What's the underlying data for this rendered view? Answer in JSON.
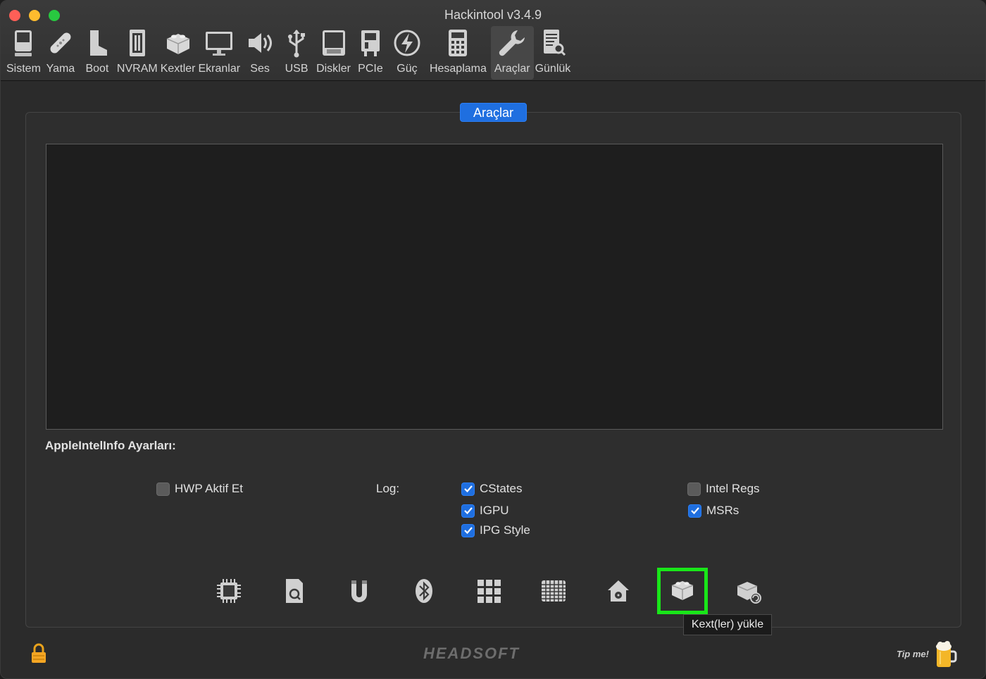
{
  "window": {
    "title": "Hackintool v3.4.9"
  },
  "toolbar": {
    "items": [
      {
        "label": "Sistem",
        "icon": "computer-icon"
      },
      {
        "label": "Yama",
        "icon": "bandage-icon"
      },
      {
        "label": "Boot",
        "icon": "boot-icon"
      },
      {
        "label": "NVRAM",
        "icon": "memory-icon"
      },
      {
        "label": "Kextler",
        "icon": "lego-brick-icon"
      },
      {
        "label": "Ekranlar",
        "icon": "display-icon"
      },
      {
        "label": "Ses",
        "icon": "speaker-icon"
      },
      {
        "label": "USB",
        "icon": "usb-icon"
      },
      {
        "label": "Diskler",
        "icon": "disk-icon"
      },
      {
        "label": "PCIe",
        "icon": "pcie-card-icon"
      },
      {
        "label": "Güç",
        "icon": "power-bolt-icon"
      },
      {
        "label": "Hesaplama",
        "icon": "calculator-icon"
      },
      {
        "label": "Araçlar",
        "icon": "wrench-icon",
        "active": true
      },
      {
        "label": "Günlük",
        "icon": "log-search-icon"
      }
    ]
  },
  "panel": {
    "tab_label": "Araçlar",
    "section_title": "AppleIntelInfo Ayarları:",
    "options": {
      "hwp": {
        "label": "HWP Aktif Et",
        "checked": false
      },
      "log_label": "Log:",
      "cstates": {
        "label": "CStates",
        "checked": true
      },
      "igpu": {
        "label": "IGPU",
        "checked": true
      },
      "ipg_style": {
        "label": "IPG Style",
        "checked": true
      },
      "intel_regs": {
        "label": "Intel Regs",
        "checked": false
      },
      "msrs": {
        "label": "MSRs",
        "checked": true
      }
    }
  },
  "tools": [
    {
      "icon": "cpu-chip-icon"
    },
    {
      "icon": "search-file-icon"
    },
    {
      "icon": "magnet-icon"
    },
    {
      "icon": "bluetooth-icon"
    },
    {
      "icon": "grid-icon"
    },
    {
      "icon": "memory-grid-icon"
    },
    {
      "icon": "home-disk-icon"
    },
    {
      "icon": "install-kext-icon",
      "highlighted": true
    },
    {
      "icon": "rebuild-kext-cache-icon"
    }
  ],
  "tooltip": "Kext(ler) yükle",
  "footer": {
    "brand": "HEADSOFT",
    "tip_label": "Tip me!"
  },
  "colors": {
    "accent": "#1f6fe0",
    "highlight": "#19e619"
  }
}
